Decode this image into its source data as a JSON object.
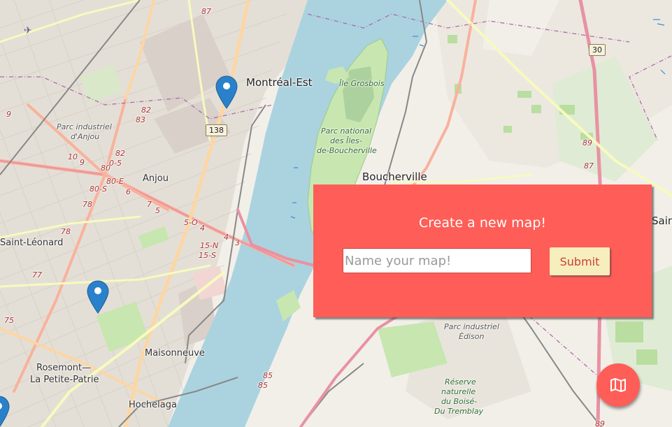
{
  "map": {
    "places": {
      "montreal_est": "Montréal-Est",
      "boucherville": "Boucherville",
      "anjou": "Anjou",
      "saint_leonard": "Saint-Léonard",
      "maisonneuve": "Maisonneuve",
      "rosemont_1": "Rosemont—",
      "rosemont_2": "La Petite-Patrie",
      "hochelaga": "Hochelaga",
      "saint_edge": "Sain"
    },
    "parks": {
      "iles_line1": "Parc national",
      "iles_line2": "des Îles-",
      "iles_line3": "de-Boucherville",
      "grosbois": "Île Grosbois",
      "parc_anjou_1": "Parc industriel",
      "parc_anjou_2": "d'Anjou",
      "parc_edison_1": "Parc industriel",
      "parc_edison_2": "Édison",
      "reserve_1": "Réserve",
      "reserve_2": "naturelle",
      "reserve_3": "du Boisé-",
      "reserve_4": "Du Tremblay"
    },
    "shields": {
      "r138": "138",
      "r30": "30"
    },
    "road_numbers": {
      "n87a": "87",
      "n82": "82",
      "n83": "83",
      "n9": "9",
      "n10": "10",
      "n9b": "9",
      "n80": "80",
      "n82b": "82",
      "n05": "0-5",
      "n80e": "80-E",
      "n80s": "80-S",
      "n6": "6",
      "n7": "7",
      "n5": "5",
      "n78": "78",
      "n78b": "78",
      "n5o": "5-O",
      "n4": "4",
      "n4b": "4",
      "n3": "3",
      "n15n": "15-N",
      "n15s": "15-S",
      "n77": "77",
      "n75": "75",
      "n85": "85",
      "n85b": "85",
      "n89": "89",
      "n87b": "87",
      "n89b": "89"
    }
  },
  "modal": {
    "title": "Create a new map!",
    "input_placeholder": "Name your map!",
    "input_value": "",
    "submit_label": "Submit",
    "background_color": "#fe5e57",
    "button_color": "#f7eebd"
  },
  "fab": {
    "icon": "map-icon",
    "color": "#fe5e57"
  },
  "markers": [
    {
      "name": "marker-montreal-est",
      "color": "#2a81cb"
    },
    {
      "name": "marker-rosemont",
      "color": "#2a81cb"
    },
    {
      "name": "marker-edge",
      "color": "#2a81cb"
    }
  ]
}
